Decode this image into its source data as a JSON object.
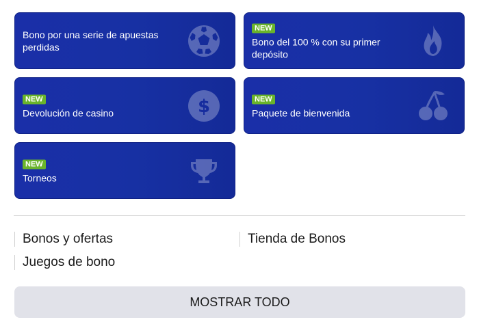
{
  "cards": [
    {
      "badge": "",
      "title": "Bono por una serie de apuestas perdidas",
      "icon": "soccer-ball-icon"
    },
    {
      "badge": "NEW",
      "title": "Bono del 100 % con su primer depósito",
      "icon": "flame-icon"
    },
    {
      "badge": "NEW",
      "title": "Devolución de casino",
      "icon": "dollar-coin-icon"
    },
    {
      "badge": "NEW",
      "title": "Paquete de bienvenida",
      "icon": "cherries-icon"
    },
    {
      "badge": "NEW",
      "title": "Torneos",
      "icon": "trophy-icon"
    }
  ],
  "links": [
    {
      "label": "Bonos y ofertas"
    },
    {
      "label": "Tienda de Bonos"
    },
    {
      "label": "Juegos de bono"
    }
  ],
  "show_all_label": "MOSTRAR TODO",
  "colors": {
    "card_bg": "#1a2fa8",
    "badge": "#6ab42b",
    "button_bg": "#e1e2e9"
  }
}
